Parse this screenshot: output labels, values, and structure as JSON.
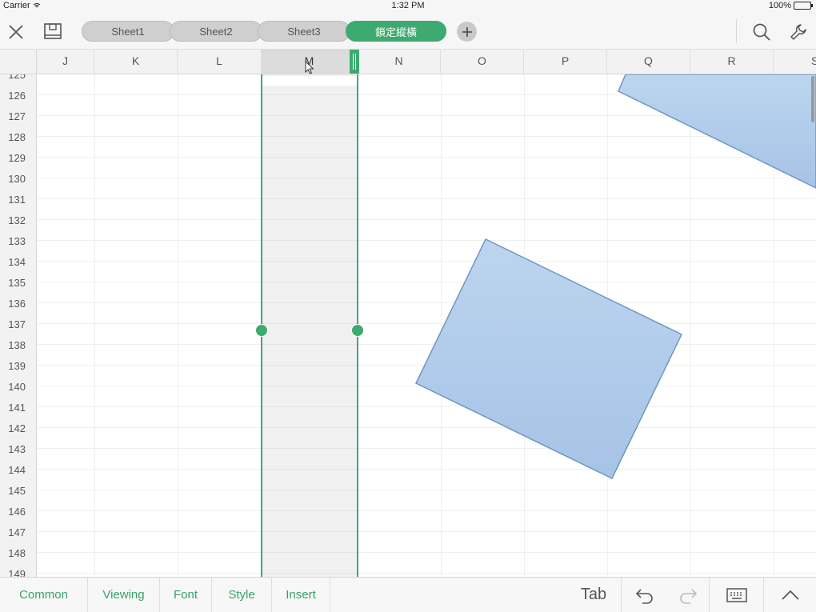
{
  "status_bar": {
    "carrier": "Carrier",
    "time": "1:32 PM",
    "battery": "100%"
  },
  "toolbar": {
    "sheets": [
      "Sheet1",
      "Sheet2",
      "Sheet3",
      "鎖定縱橫"
    ],
    "active_sheet": "鎖定縱橫"
  },
  "columns": [
    "J",
    "K",
    "L",
    "M",
    "N",
    "O",
    "P",
    "Q",
    "R",
    "S"
  ],
  "selected_column": "M",
  "rows": [
    "125",
    "126",
    "127",
    "128",
    "129",
    "130",
    "131",
    "132",
    "133",
    "134",
    "135",
    "136",
    "137",
    "138",
    "139",
    "140",
    "141",
    "142",
    "143",
    "144",
    "145",
    "146",
    "147",
    "148",
    "149"
  ],
  "bottom_bar": {
    "tabs": [
      "Common",
      "Viewing",
      "Font",
      "Style",
      "Insert"
    ],
    "tab_key_label": "Tab"
  },
  "colors": {
    "accent": "#3daa6f",
    "shape_fill": "#a9c6e8",
    "shape_stroke": "#6f95c4"
  },
  "icons": [
    "close-icon",
    "save-icon",
    "add-sheet-icon",
    "search-icon",
    "wrench-icon",
    "undo-icon",
    "redo-icon",
    "keyboard-icon",
    "chevron-up-icon",
    "wifi-icon",
    "battery-icon"
  ]
}
